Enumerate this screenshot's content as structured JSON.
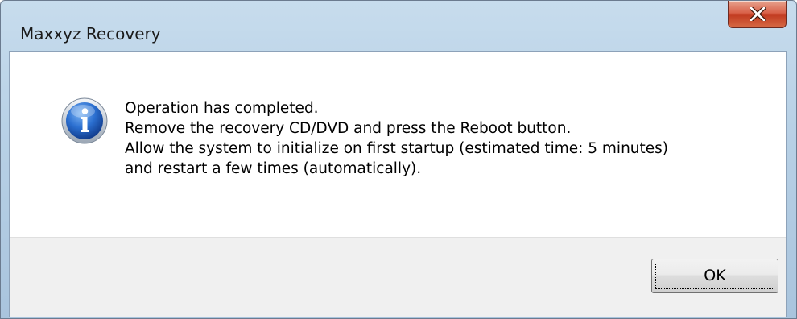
{
  "window": {
    "title": "Maxxyz Recovery",
    "close_icon": "close-icon"
  },
  "dialog": {
    "icon": "info-icon",
    "message_lines": [
      "Operation has completed.",
      "Remove the recovery CD/DVD and press the Reboot button.",
      "Allow the system to initialize on first startup (estimated time: 5 minutes)",
      "and restart a few times (automatically)."
    ],
    "ok_label": "OK"
  },
  "colors": {
    "title_bar": "#b8d1e6",
    "close_button": "#c94a2c",
    "button_area": "#f0f0f0",
    "info_icon_blue": "#1f5fbf"
  }
}
